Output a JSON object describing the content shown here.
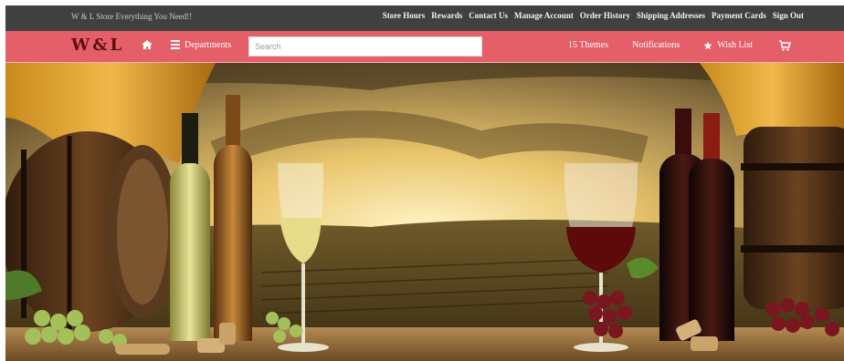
{
  "topbar": {
    "tagline": "W & L Store   Everything You Need!!",
    "links": [
      "Store Hours",
      "Rewards",
      "Contact Us",
      "Manage Account",
      "Order History",
      "Shipping Addresses",
      "Payment Cards",
      "Sign Out"
    ]
  },
  "navbar": {
    "logo": "W&L",
    "departments_label": "Departments",
    "search_placeholder": "Search",
    "themes_label": "Themes",
    "themes_count": "15",
    "notifications_label": "Notifications",
    "wishlist_label": "Wish List"
  },
  "colors": {
    "topbar_bg": "#404040",
    "navbar_bg": "#e45f68",
    "logo_color": "#5b0e12"
  },
  "hero": {
    "subject": "wine bottles, glasses, barrels and grapes over a vineyard at sunset"
  }
}
